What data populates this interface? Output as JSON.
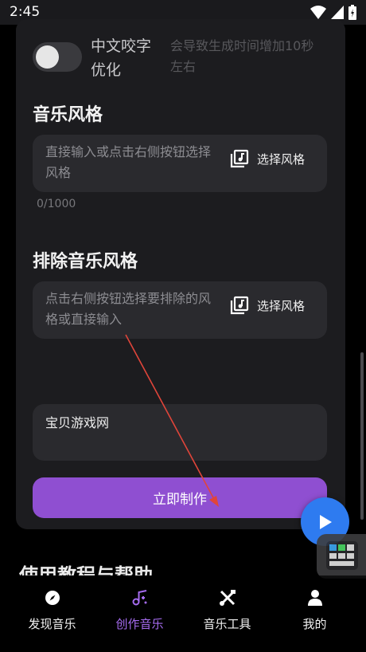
{
  "status_bar": {
    "time": "2:45",
    "icons": [
      "wifi-icon",
      "signal-icon",
      "battery-icon"
    ]
  },
  "lyrics_option": {
    "toggle_on": false,
    "label": "中文咬字优化",
    "hint": "会导致生成时间增加10秒左右"
  },
  "music_style": {
    "title": "音乐风格",
    "placeholder": "直接输入或点击右侧按钮选择风格",
    "button_label": "选择风格",
    "counter": "0/1000"
  },
  "exclude_style": {
    "title": "排除音乐风格",
    "placeholder": "点击右侧按钮选择要排除的风格或直接输入",
    "button_label": "选择风格"
  },
  "name_field": {
    "value": "宝贝游戏网"
  },
  "create_button": {
    "label": "立即制作"
  },
  "next_section": {
    "title": "使用教程与帮助"
  },
  "bottom_nav": {
    "active_index": 1,
    "items": [
      {
        "label": "发现音乐",
        "icon": "compass-icon"
      },
      {
        "label": "创作音乐",
        "icon": "music-create-icon"
      },
      {
        "label": "音乐工具",
        "icon": "tools-icon"
      },
      {
        "label": "我的",
        "icon": "user-icon"
      }
    ]
  },
  "colors": {
    "accent": "#8f4fd1",
    "fab": "#2e7bf0",
    "annotation_arrow": "#e0453a",
    "active_nav": "#a66cf0"
  }
}
